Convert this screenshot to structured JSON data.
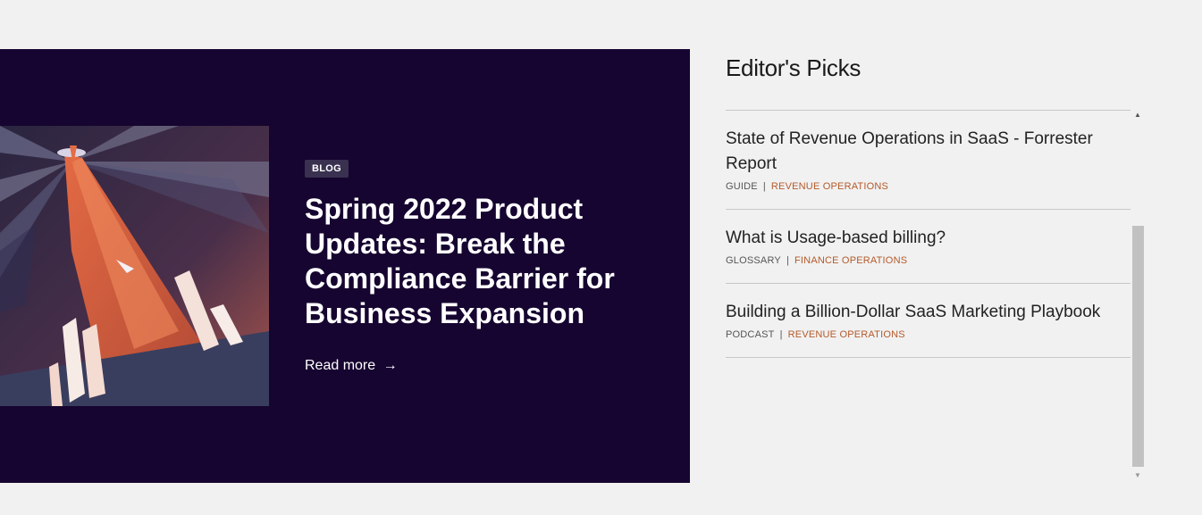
{
  "featured": {
    "badge": "BLOG",
    "title": "Spring 2022 Product Updates: Break the Compliance Barrier for Business Expansion",
    "read_more": "Read more",
    "read_more_arrow": "→",
    "image_alt": "rocket-illustration"
  },
  "editors_picks": {
    "heading": "Editor's Picks",
    "items": [
      {
        "title": "State of Revenue Operations in SaaS - Forrester Report",
        "type": "GUIDE",
        "separator": "|",
        "category": "REVENUE OPERATIONS"
      },
      {
        "title": "What is Usage-based billing?",
        "type": "GLOSSARY",
        "separator": "|",
        "category": "FINANCE OPERATIONS"
      },
      {
        "title": "Building a Billion-Dollar SaaS Marketing Playbook",
        "type": "PODCAST",
        "separator": "|",
        "category": "REVENUE OPERATIONS"
      }
    ]
  },
  "scrollbar": {
    "up_arrow": "▲",
    "down_arrow": "▼"
  },
  "colors": {
    "hero_background": "#160530",
    "category_accent": "#b45a2a",
    "page_background": "#f1f1f1"
  }
}
